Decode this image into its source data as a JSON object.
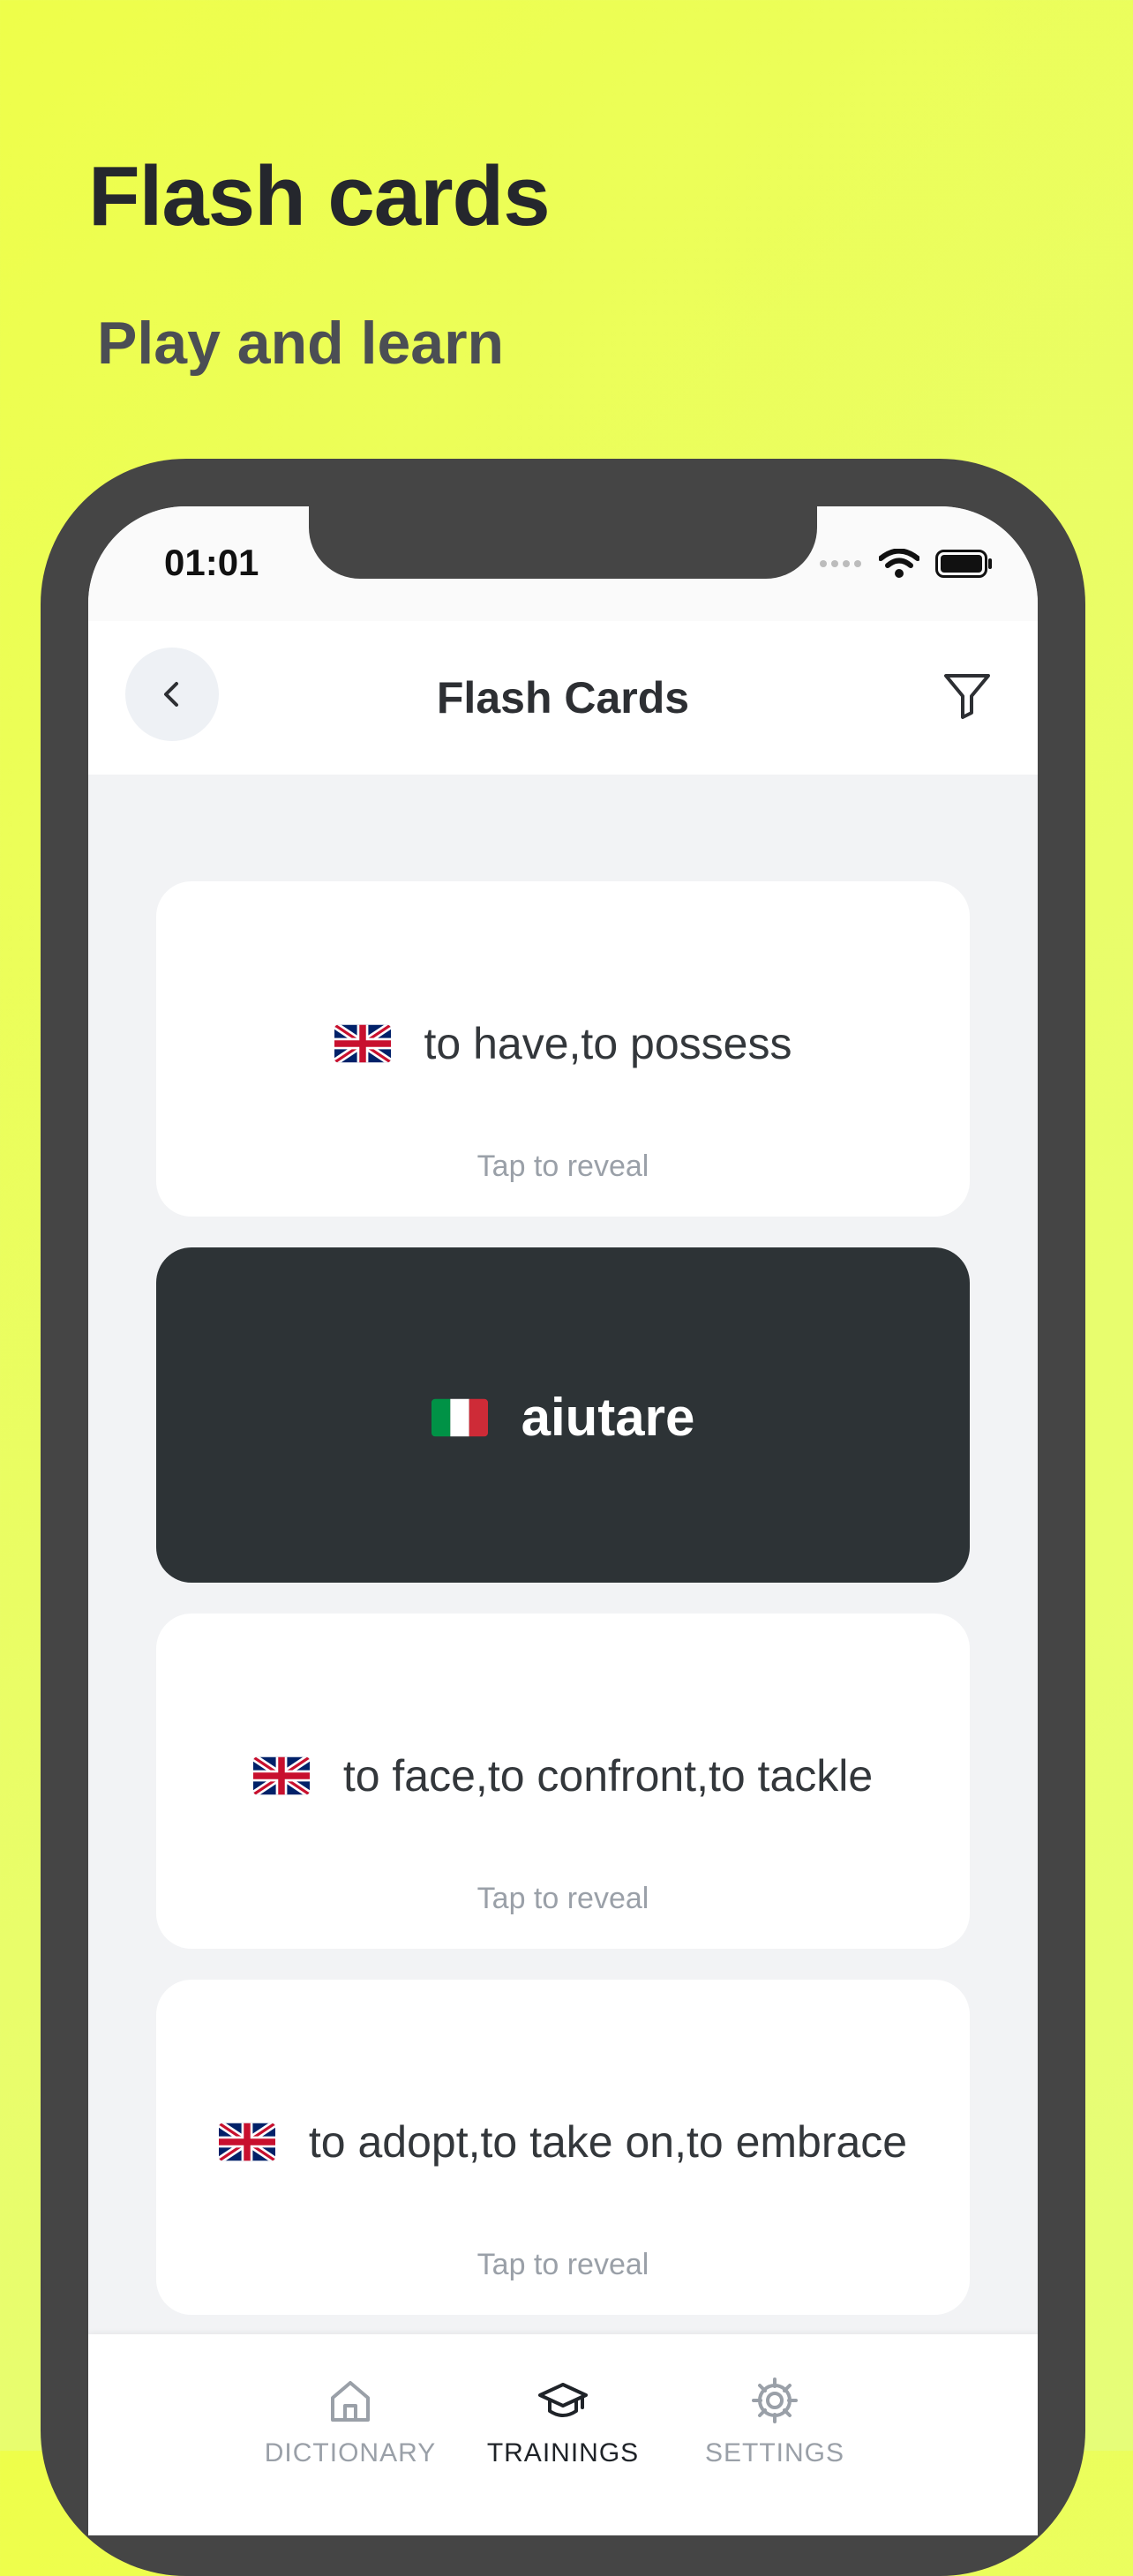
{
  "promo": {
    "title": "Flash cards",
    "subtitle": "Play and learn"
  },
  "status_bar": {
    "time": "01:01"
  },
  "nav": {
    "title": "Flash Cards"
  },
  "cards": [
    {
      "flag": "uk-flag",
      "text": "to have,to possess",
      "hint": "Tap to reveal",
      "revealed": false
    },
    {
      "flag": "italy-flag",
      "text": "aiutare",
      "hint": "",
      "revealed": true
    },
    {
      "flag": "uk-flag",
      "text": "to face,to confront,to tackle",
      "hint": "Tap to reveal",
      "revealed": false
    },
    {
      "flag": "uk-flag",
      "text": "to adopt,to take on,to embrace",
      "hint": "Tap to reveal",
      "revealed": false
    }
  ],
  "tabs": [
    {
      "label": "DICTIONARY",
      "icon": "home-icon",
      "active": false
    },
    {
      "label": "TRAININGS",
      "icon": "graduation-cap-icon",
      "active": true
    },
    {
      "label": "SETTINGS",
      "icon": "gear-icon",
      "active": false
    }
  ],
  "colors": {
    "background": "#eefe4a",
    "dark_card": "#2d3336",
    "inactive_tab": "#9aa0a8",
    "active_tab": "#1f2328"
  }
}
